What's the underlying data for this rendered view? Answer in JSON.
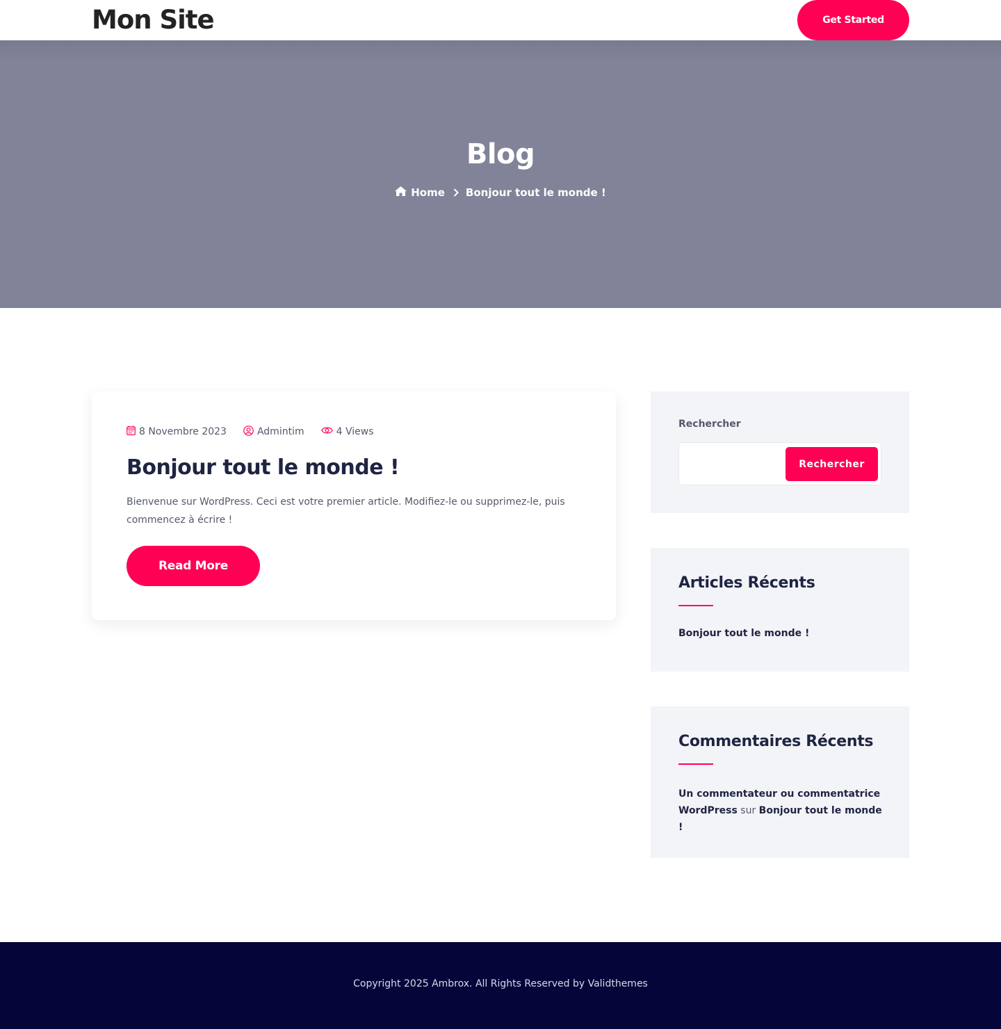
{
  "header": {
    "logo": "Mon Site",
    "cta_label": "Get Started"
  },
  "hero": {
    "title": "Blog",
    "breadcrumb": {
      "home": "Home",
      "current": "Bonjour tout le monde !"
    }
  },
  "post": {
    "date": "8 Novembre 2023",
    "author": "Admintim",
    "views": "4 Views",
    "title": "Bonjour tout le monde !",
    "excerpt": "Bienvenue sur WordPress. Ceci est votre premier article. Modifiez-le ou supprimez-le, puis commencez à écrire !",
    "read_more": "Read More"
  },
  "sidebar": {
    "search": {
      "label": "Rechercher",
      "placeholder": "",
      "button": "Rechercher"
    },
    "recent_posts": {
      "title": "Articles Récents",
      "items": [
        "Bonjour tout le monde !"
      ]
    },
    "recent_comments": {
      "title": "Commentaires Récents",
      "author": "Un commentateur ou commentatrice WordPress",
      "connector": "sur",
      "post": "Bonjour tout le monde !"
    }
  },
  "footer": {
    "copyright": "Copyright 2025 Ambrox. All Rights Reserved by Validthemes"
  },
  "colors": {
    "accent": "#ff0055",
    "hero_bg": "#818498",
    "footer_bg": "#05053a",
    "widget_bg": "#f2f4f8",
    "heading": "#1f2442"
  }
}
